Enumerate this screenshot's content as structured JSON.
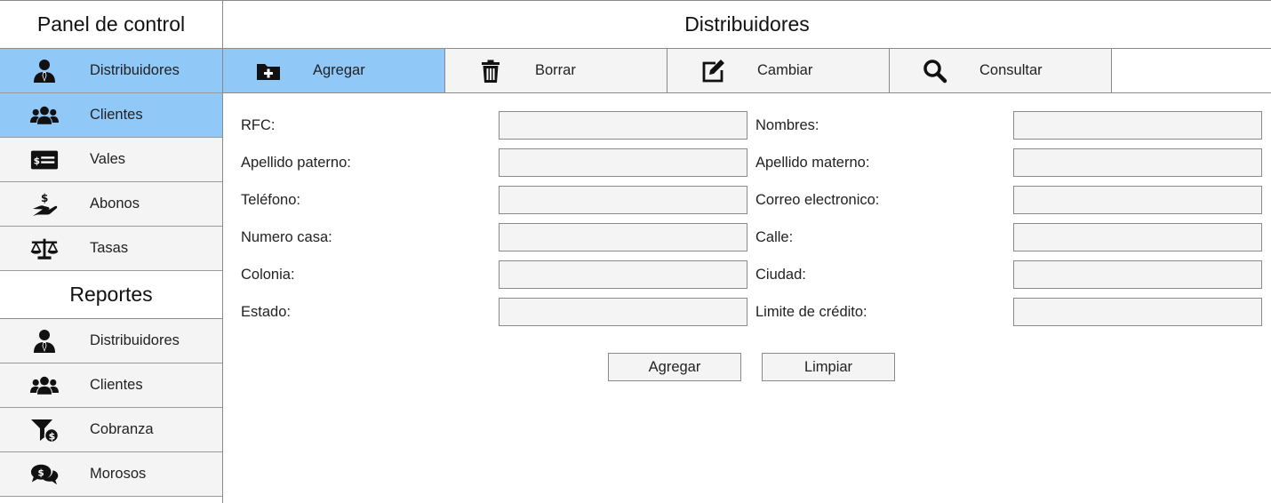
{
  "sidebar": {
    "title": "Panel de control",
    "items": [
      {
        "label": "Distribuidores",
        "icon": "user-tie-icon",
        "active": true
      },
      {
        "label": "Clientes",
        "icon": "users-icon",
        "active": true
      },
      {
        "label": "Vales",
        "icon": "money-check-icon",
        "active": false
      },
      {
        "label": "Abonos",
        "icon": "hand-dollar-icon",
        "active": false
      },
      {
        "label": "Tasas",
        "icon": "balance-scale-icon",
        "active": false
      }
    ],
    "reports_title": "Reportes",
    "reports": [
      {
        "label": "Distribuidores",
        "icon": "user-tie-icon"
      },
      {
        "label": "Clientes",
        "icon": "users-icon"
      },
      {
        "label": "Cobranza",
        "icon": "filter-dollar-icon"
      },
      {
        "label": "Morosos",
        "icon": "comments-dollar-icon"
      }
    ]
  },
  "main": {
    "title": "Distribuidores",
    "toolbar": [
      {
        "label": "Agregar",
        "icon": "folder-plus-icon",
        "active": true
      },
      {
        "label": "Borrar",
        "icon": "trash-icon",
        "active": false
      },
      {
        "label": "Cambiar",
        "icon": "edit-icon",
        "active": false
      },
      {
        "label": "Consultar",
        "icon": "search-icon",
        "active": false
      }
    ],
    "form": {
      "left": [
        {
          "label": "RFC:",
          "value": ""
        },
        {
          "label": "Apellido paterno:",
          "value": ""
        },
        {
          "label": "Teléfono:",
          "value": ""
        },
        {
          "label": "Numero casa:",
          "value": ""
        },
        {
          "label": "Colonia:",
          "value": ""
        },
        {
          "label": "Estado:",
          "value": ""
        }
      ],
      "right": [
        {
          "label": "Nombres:",
          "value": ""
        },
        {
          "label": "Apellido materno:",
          "value": ""
        },
        {
          "label": "Correo electronico:",
          "value": ""
        },
        {
          "label": "Calle:",
          "value": ""
        },
        {
          "label": "Ciudad:",
          "value": ""
        },
        {
          "label": "Limite de crédito:",
          "value": ""
        }
      ]
    },
    "buttons": {
      "add": "Agregar",
      "clear": "Limpiar"
    }
  },
  "colors": {
    "active": "#90c8f8",
    "item_bg": "#f4f4f4",
    "border": "#8a8a8a"
  }
}
